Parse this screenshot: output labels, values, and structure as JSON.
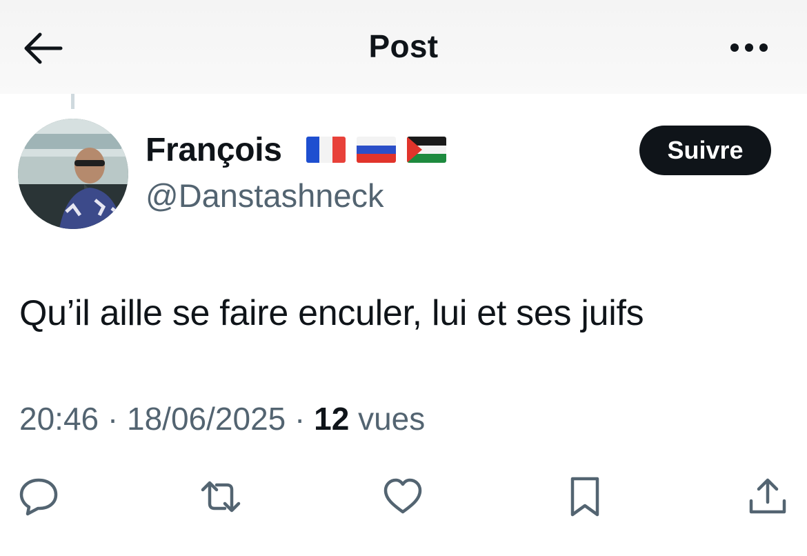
{
  "header": {
    "title": "Post"
  },
  "author": {
    "display_name": "François",
    "flags": [
      "france-flag",
      "russia-flag",
      "palestine-flag"
    ],
    "handle": "@Danstashneck",
    "follow_label": "Suivre"
  },
  "tweet": {
    "text": "Qu’il aille se faire enculer, lui et ses juifs",
    "time": "20:46",
    "date": "18/06/2025",
    "separator": " · ",
    "views_count": "12",
    "views_label": "vues"
  },
  "actions": [
    {
      "icon": "reply-icon"
    },
    {
      "icon": "retweet-icon"
    },
    {
      "icon": "like-icon"
    },
    {
      "icon": "bookmark-icon"
    },
    {
      "icon": "share-icon"
    }
  ],
  "colors": {
    "text": "#0f1419",
    "secondary": "#536471",
    "button_bg": "#0f1419",
    "thread_line": "#cfd9de"
  }
}
